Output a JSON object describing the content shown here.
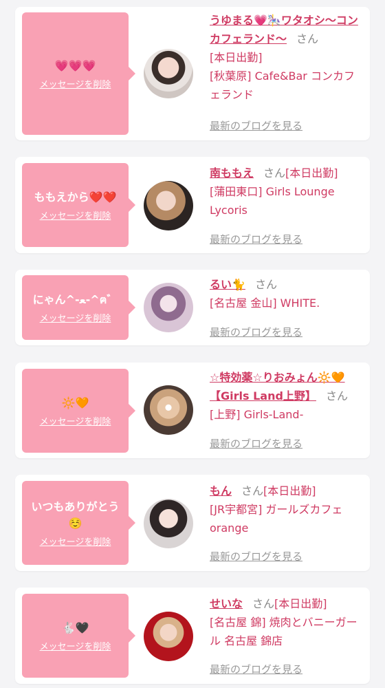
{
  "colors": {
    "accent": "#cf3a62",
    "bubble": "#f9a1b4",
    "background": "#f4f4f6"
  },
  "delete_label": "メッセージを削除",
  "blog_label": "最新のブログを見る",
  "san_label": "さん",
  "cards": [
    {
      "message": "💗💗💗",
      "name": "うゆまる💗🎠ワタオシ〜コンカフェランド〜",
      "status": "[本日出勤]",
      "shop": "[秋葉原] Cafe&Bar コンカフェランド"
    },
    {
      "message": "ももえから❤️❤️",
      "name": "南ももえ",
      "status": "[本日出勤]",
      "shop": "[蒲田東口] Girls Lounge Lycoris"
    },
    {
      "message": "にゃん^-ﻌ-^ฅ゛",
      "name": "るい🐈",
      "status": "",
      "shop": "[名古屋 金山] WHITE."
    },
    {
      "message": "🔆🧡",
      "name": "☆特効薬☆りおみょん🔆🧡【Girls Land上野】",
      "status": "",
      "shop": "[上野] Girls-Land-"
    },
    {
      "message": "いつもありがとう☺️",
      "name": "もん",
      "status": "[本日出勤]",
      "shop": "[JR宇都宮] ガールズカフェ orange"
    },
    {
      "message": "🐇🖤",
      "name": "せいな",
      "status": "[本日出勤]",
      "shop": "[名古屋 錦] 焼肉とバニーガール 名古屋 錦店"
    }
  ]
}
